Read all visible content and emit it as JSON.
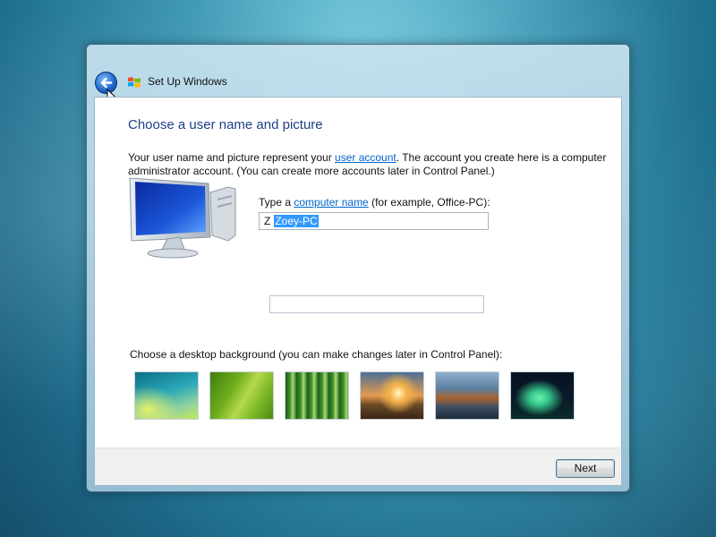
{
  "window": {
    "title": "Set Up Windows",
    "back_icon": "back-arrow-icon",
    "logo_icon": "windows-logo-icon"
  },
  "page": {
    "title": "Choose a user name and picture",
    "intro_before_link": "Your user name and picture represent your ",
    "intro_link": "user account",
    "intro_after_link": ". The account you create here is a computer administrator account. (You can create more accounts later in Control Panel.)"
  },
  "computer_name": {
    "label_prefix": "Type a ",
    "label_link": "computer name",
    "label_suffix": " (for example, Office-PC):",
    "typed_char": "Z",
    "selected_value": "Zoey-PC"
  },
  "background": {
    "label": "Choose a desktop background (you can make changes later in Control Panel):",
    "thumbnails": [
      {
        "name": "aurora-swirl",
        "colors": [
          "#2aa8b8",
          "#b8e04a"
        ]
      },
      {
        "name": "green-leaf",
        "colors": [
          "#5d9e16",
          "#b6d94a"
        ]
      },
      {
        "name": "bamboo",
        "colors": [
          "#2d7a24",
          "#a9d876"
        ]
      },
      {
        "name": "sunset-field",
        "colors": [
          "#f6b34a",
          "#4a3320"
        ]
      },
      {
        "name": "mountain-lake",
        "colors": [
          "#5c7ea0",
          "#c06a2e"
        ]
      },
      {
        "name": "northern-lights",
        "colors": [
          "#0a1a2a",
          "#35c48a"
        ]
      }
    ]
  },
  "footer": {
    "next_label": "Next"
  }
}
